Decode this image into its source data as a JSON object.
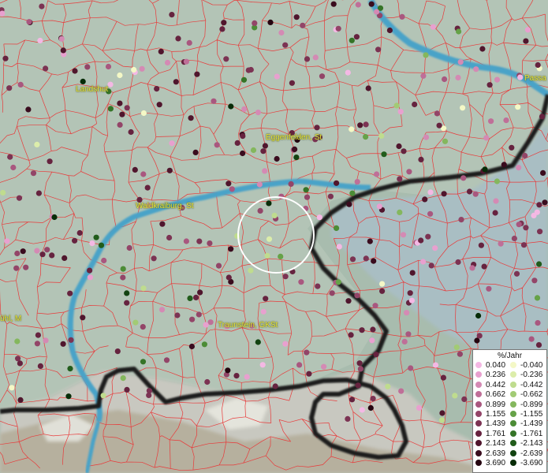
{
  "places": [
    {
      "name": "Landshut",
      "id": "landshut"
    },
    {
      "name": "Eggenfelden, St",
      "id": "eggenfelden"
    },
    {
      "name": "Passa",
      "id": "passau"
    },
    {
      "name": "Waldkraiburg, St",
      "id": "waldkraiburg"
    },
    {
      "name": "Traunstein, GKSt",
      "id": "traunstein"
    },
    {
      "name": "ühl, M",
      "id": "muehldorf-partial"
    }
  ],
  "legend": {
    "title": "%/Jahr",
    "positive": [
      {
        "value": "0.040",
        "color": "#f4b8e4"
      },
      {
        "value": "0.236",
        "color": "#e8a0cf"
      },
      {
        "value": "0.442",
        "color": "#d48ab4"
      },
      {
        "value": "0.662",
        "color": "#bf6f98"
      },
      {
        "value": "0.899",
        "color": "#a9577f"
      },
      {
        "value": "1.155",
        "color": "#934568"
      },
      {
        "value": "1.439",
        "color": "#7c3353"
      },
      {
        "value": "1.761",
        "color": "#66233f"
      },
      {
        "value": "2.143",
        "color": "#50162d"
      },
      {
        "value": "2.639",
        "color": "#3a0c1e"
      },
      {
        "value": "3.690",
        "color": "#250510"
      }
    ],
    "negative": [
      {
        "value": "-0.040",
        "color": "#f4f8c6"
      },
      {
        "value": "-0.236",
        "color": "#dcedaa"
      },
      {
        "value": "-0.442",
        "color": "#bfdc8e"
      },
      {
        "value": "-0.662",
        "color": "#a2cb74"
      },
      {
        "value": "-0.899",
        "color": "#84b75d"
      },
      {
        "value": "-1.155",
        "color": "#66a248"
      },
      {
        "value": "-1.439",
        "color": "#4c8c36"
      },
      {
        "value": "-1.761",
        "color": "#357427"
      },
      {
        "value": "-2.143",
        "color": "#215c1b"
      },
      {
        "value": "-2.639",
        "color": "#124311"
      },
      {
        "value": "-3.690",
        "color": "#072c08"
      }
    ]
  },
  "colors": {
    "river": "#4aa3c8",
    "boundary": "#e83a3a",
    "border": "#1e1e1e",
    "selection": "#ffffff"
  }
}
